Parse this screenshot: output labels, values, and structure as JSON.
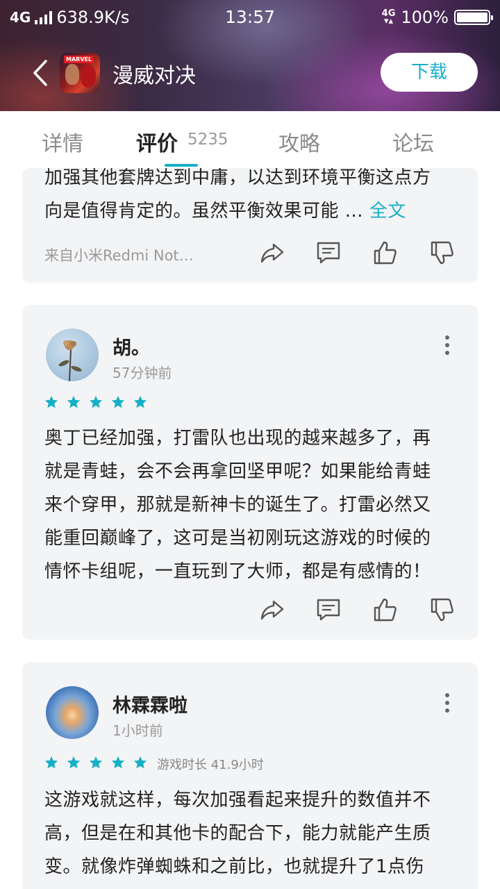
{
  "status_bar": {
    "network": "4G",
    "speed": "638.9K/s",
    "time": "13:57",
    "network2": "4G",
    "battery": "100%"
  },
  "header": {
    "app_title": "漫威对决",
    "download_label": "下载",
    "icon_badge": "MARVEL"
  },
  "tabs": [
    {
      "label": "详情"
    },
    {
      "label": "评价",
      "count": "5235"
    },
    {
      "label": "攻略"
    },
    {
      "label": "论坛"
    }
  ],
  "reviews": [
    {
      "text_line1": "加强其他套牌达到中庸，以达到环境平衡这点方",
      "text_line2": "向是值得肯定的。虽然平衡效果可能 ...",
      "full_text_label": "全文",
      "source": "来自小米Redmi Not…"
    },
    {
      "user": "胡。",
      "time": "57分钟前",
      "stars": 5,
      "lines": [
        "奥丁已经加强，打雷队也出现的越来越多了，再",
        "就是青蛙，会不会再拿回坚甲呢？如果能给青蛙",
        "来个穿甲，那就是新神卡的诞生了。打雷必然又",
        "能重回巅峰了，这可是当初刚玩这游戏的时候的",
        "情怀卡组呢，一直玩到了大师，都是有感情的！"
      ]
    },
    {
      "user": "林霖霖啦",
      "time": "1小时前",
      "stars": 5,
      "playtime": "游戏时长 41.9小时",
      "lines": [
        "这游戏就这样，每次加强看起来提升的数值并不",
        "高，但是在和其他卡的配合下，能力就能产生质",
        "变。就像炸弹蜘蛛和之前比，也就提升了1点伤"
      ]
    }
  ],
  "colors": {
    "accent": "#16b0c6",
    "card_bg": "#f3f4f6",
    "star": "#16b0c6"
  }
}
